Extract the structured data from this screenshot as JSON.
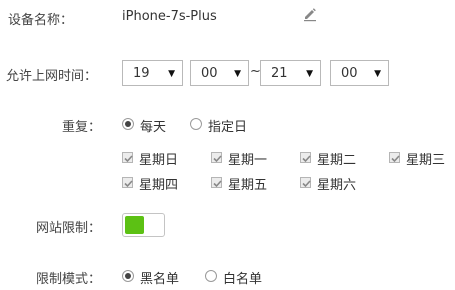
{
  "device": {
    "label": "设备名称：",
    "value": "iPhone-7s-Plus"
  },
  "time": {
    "label": "允许上网时间：",
    "start_hour": "19",
    "start_min": "00",
    "separator": "~",
    "end_hour": "21",
    "end_min": "00"
  },
  "repeat": {
    "label": "重复：",
    "options": [
      "每天",
      "指定日"
    ],
    "selected": "每天",
    "days": [
      "星期日",
      "星期一",
      "星期二",
      "星期三",
      "星期四",
      "星期五",
      "星期六"
    ]
  },
  "site_limit": {
    "label": "网站限制：",
    "enabled": true,
    "accent": "#5cc114"
  },
  "limit_mode": {
    "label": "限制模式：",
    "options": [
      "黑名单",
      "白名单"
    ],
    "selected": "黑名单"
  }
}
